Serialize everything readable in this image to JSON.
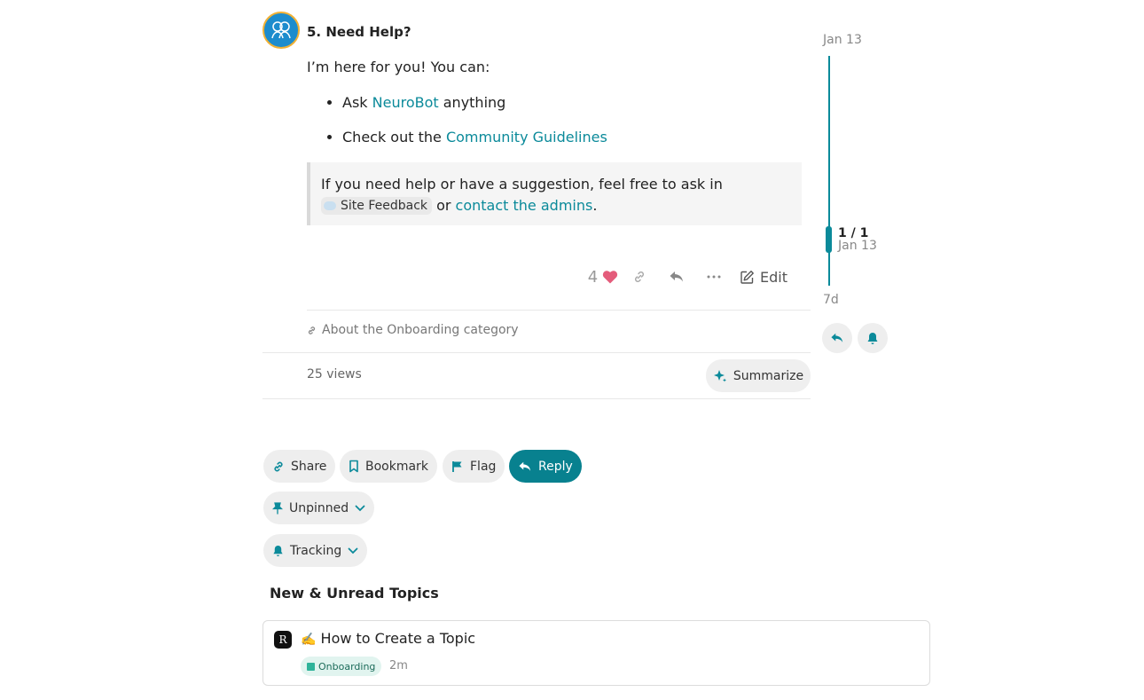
{
  "post": {
    "title": "5. Need Help?",
    "date": "Jan 13",
    "intro": "I’m here for you! You can:",
    "bullets": [
      {
        "prefix": "Ask ",
        "link": "NeuroBot",
        "suffix": " anything"
      },
      {
        "prefix": "Check out the ",
        "link": "Community Guidelines",
        "suffix": ""
      }
    ],
    "quote": {
      "line1": "If you need help or have a suggestion, feel free to ask in",
      "chip": "Site Feedback",
      "or": " or ",
      "link": "contact the admins",
      "end": "."
    },
    "like_count": "4",
    "edit_label": "Edit",
    "link_text": "About the Onboarding category",
    "views": "25 views",
    "summarize_label": "Summarize"
  },
  "timeline": {
    "top_date": "Jan 13",
    "count": "1 / 1",
    "current_date": "Jan 13",
    "end_label": "7d"
  },
  "footer": {
    "share": "Share",
    "bookmark": "Bookmark",
    "flag": "Flag",
    "reply": "Reply",
    "pinned": "Unpinned",
    "notification": "Tracking"
  },
  "suggested": {
    "title": "New & Unread Topics",
    "topics": [
      {
        "avatar_letter": "R",
        "emoji": "✍️",
        "title": "How to Create a Topic",
        "category": "Onboarding",
        "age": "2m"
      }
    ]
  },
  "colors": {
    "accent": "#0b8a9a",
    "primary_button": "#08818f",
    "like_heart": "#e45c7b",
    "category": "#2fb39a"
  }
}
